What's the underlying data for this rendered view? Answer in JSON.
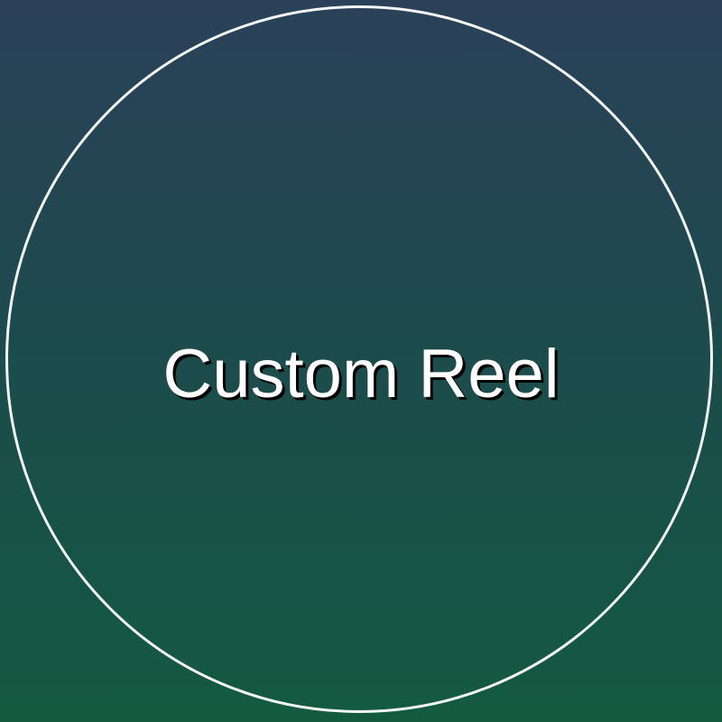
{
  "label": {
    "title": "Custom Reel"
  },
  "colors": {
    "background_top": "#2b4159",
    "background_bottom": "#135a41",
    "ring": "#ffffff",
    "text": "#ffffff",
    "text_shadow": "#000000"
  }
}
